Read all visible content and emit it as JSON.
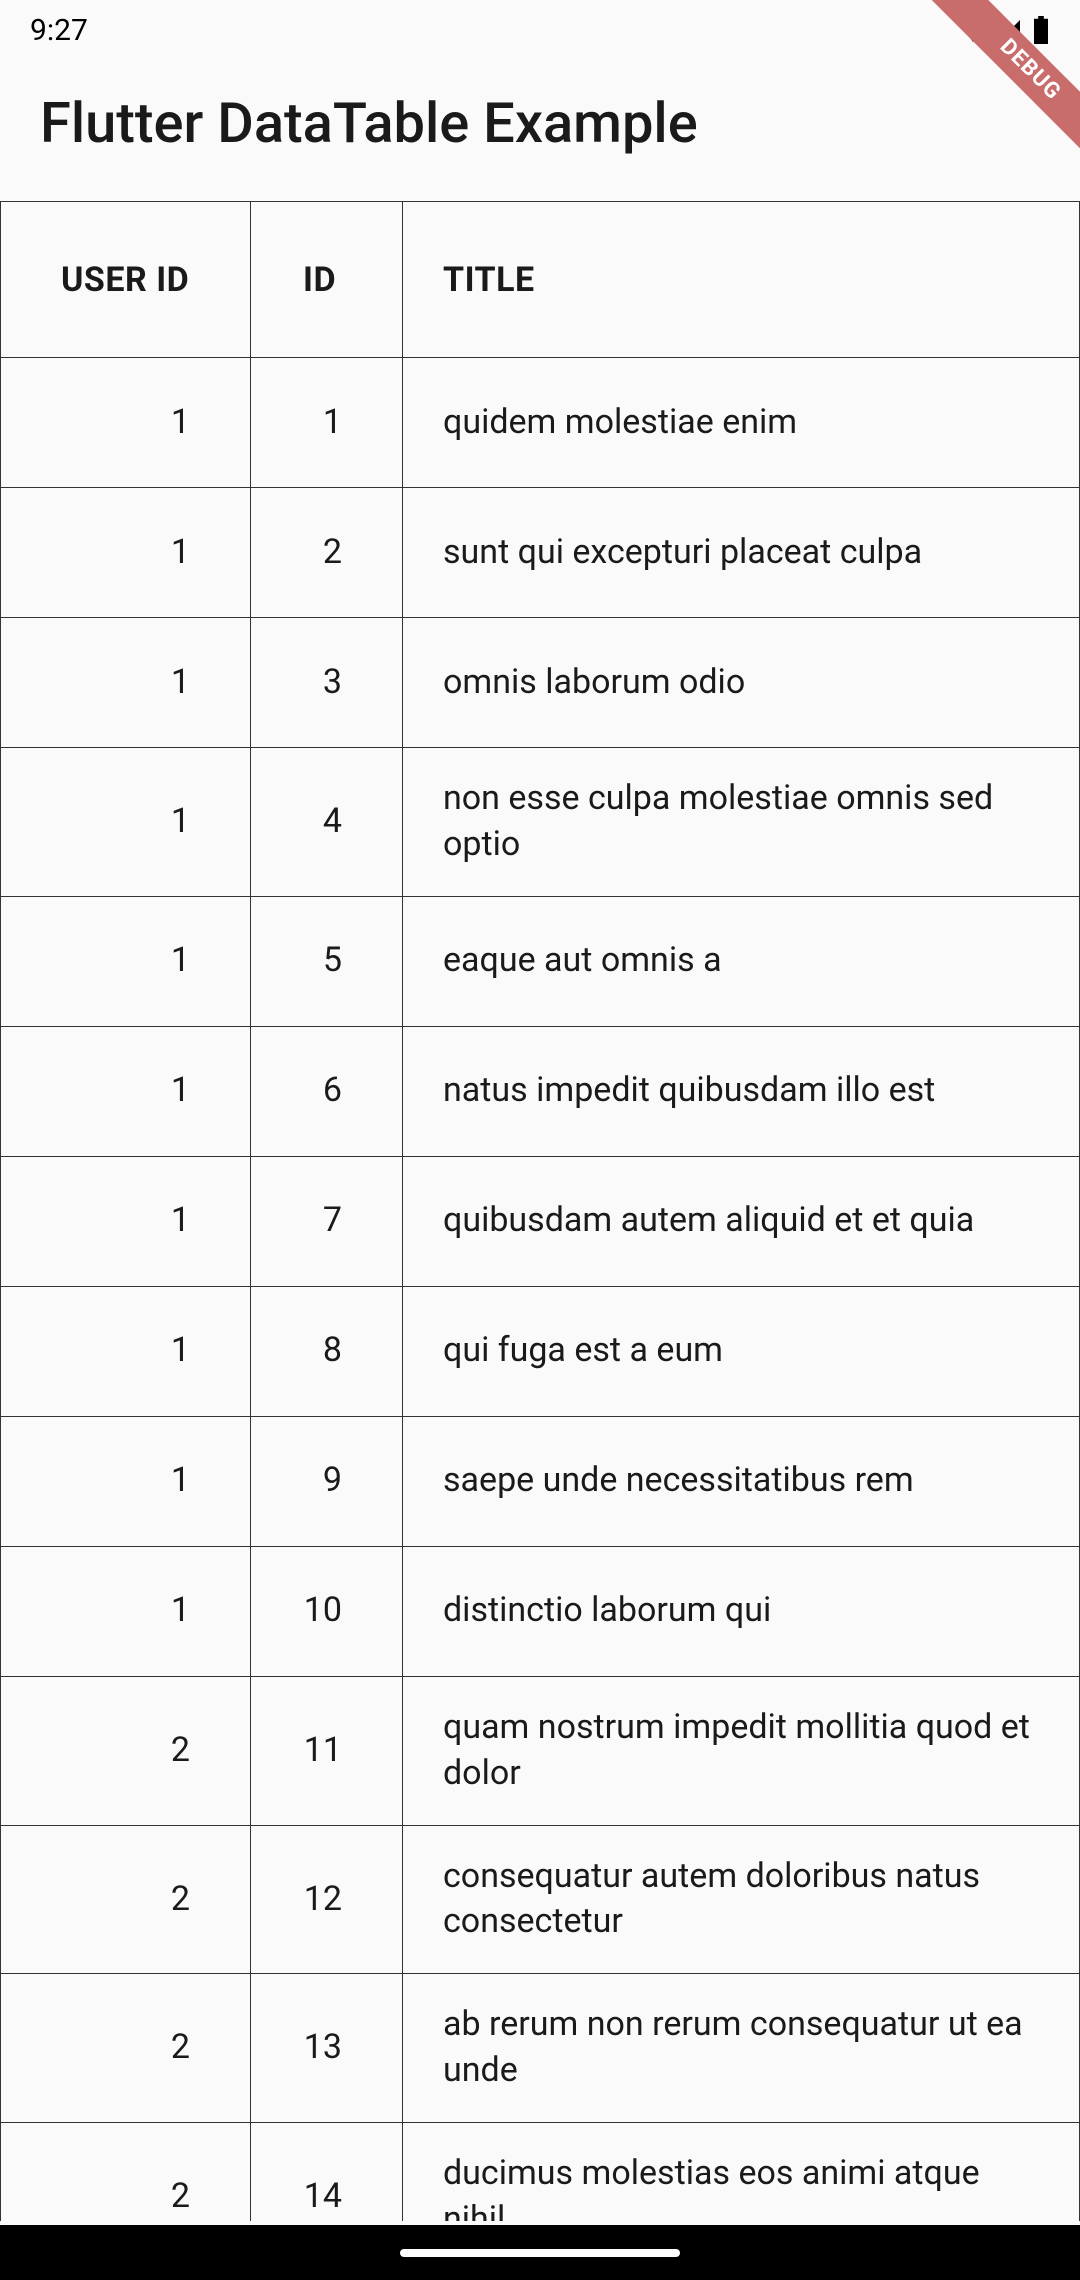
{
  "statusBar": {
    "time": "9:27"
  },
  "debugBanner": "DEBUG",
  "appBar": {
    "title": "Flutter DataTable Example"
  },
  "table": {
    "columns": {
      "userId": "USER ID",
      "id": "ID",
      "title": "TITLE"
    },
    "rows": [
      {
        "userId": "1",
        "id": "1",
        "title": "quidem molestiae enim",
        "multi": false
      },
      {
        "userId": "1",
        "id": "2",
        "title": "sunt qui excepturi placeat culpa",
        "multi": false
      },
      {
        "userId": "1",
        "id": "3",
        "title": "omnis laborum odio",
        "multi": false
      },
      {
        "userId": "1",
        "id": "4",
        "title": "non esse culpa molestiae omnis sed optio",
        "multi": true
      },
      {
        "userId": "1",
        "id": "5",
        "title": "eaque aut omnis a",
        "multi": false
      },
      {
        "userId": "1",
        "id": "6",
        "title": "natus impedit quibusdam illo est",
        "multi": true
      },
      {
        "userId": "1",
        "id": "7",
        "title": "quibusdam autem aliquid et et quia",
        "multi": true
      },
      {
        "userId": "1",
        "id": "8",
        "title": "qui fuga est a eum",
        "multi": false
      },
      {
        "userId": "1",
        "id": "9",
        "title": "saepe unde necessitatibus rem",
        "multi": false
      },
      {
        "userId": "1",
        "id": "10",
        "title": "distinctio laborum qui",
        "multi": false
      },
      {
        "userId": "2",
        "id": "11",
        "title": "quam nostrum impedit mollitia quod et dolor",
        "multi": true
      },
      {
        "userId": "2",
        "id": "12",
        "title": "consequatur autem doloribus natus consectetur",
        "multi": true
      },
      {
        "userId": "2",
        "id": "13",
        "title": "ab rerum non rerum consequatur ut ea unde",
        "multi": true
      },
      {
        "userId": "2",
        "id": "14",
        "title": "ducimus molestias eos animi atque nihil",
        "multi": true
      }
    ]
  }
}
